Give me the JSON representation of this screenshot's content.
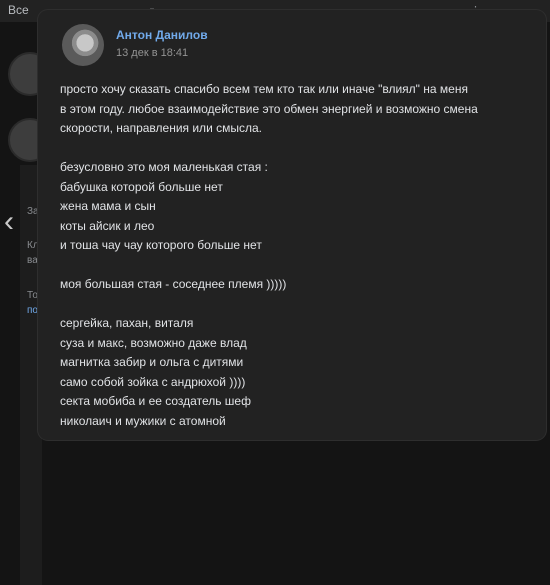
{
  "background": {
    "title": "Все",
    "top_icons": [
      "bell-icon",
      "dots-icon",
      "more-icon"
    ],
    "snippets": [
      "За",
      "Кл",
      "ва",
      "То",
      "по"
    ]
  },
  "post": {
    "author": "Антон Данилов",
    "date": "13 дек в 18:41",
    "paragraphs": [
      [
        "просто хочу сказать спасибо всем тем кто так или иначе \"влиял\" на меня",
        "в этом году. любое взаимодействие это обмен энергией и возможно смена",
        "скорости, направления или смысла."
      ],
      [
        "безусловно это моя маленькая стая :",
        "бабушка которой больше нет",
        "жена мама и сын",
        "коты айсик и лео",
        "и тоша чау чау которого больше нет"
      ],
      [
        "моя большая стая - соседнее племя )))))"
      ],
      [
        "сергейка, пахан, виталя",
        "суза и макс, возможно даже влад",
        "магнитка забир и ольга с дитями",
        "само собой зойка с андрюхой ))))",
        "секта мобиба и ее создатель шеф",
        "николаич и мужики с атомной"
      ]
    ]
  }
}
